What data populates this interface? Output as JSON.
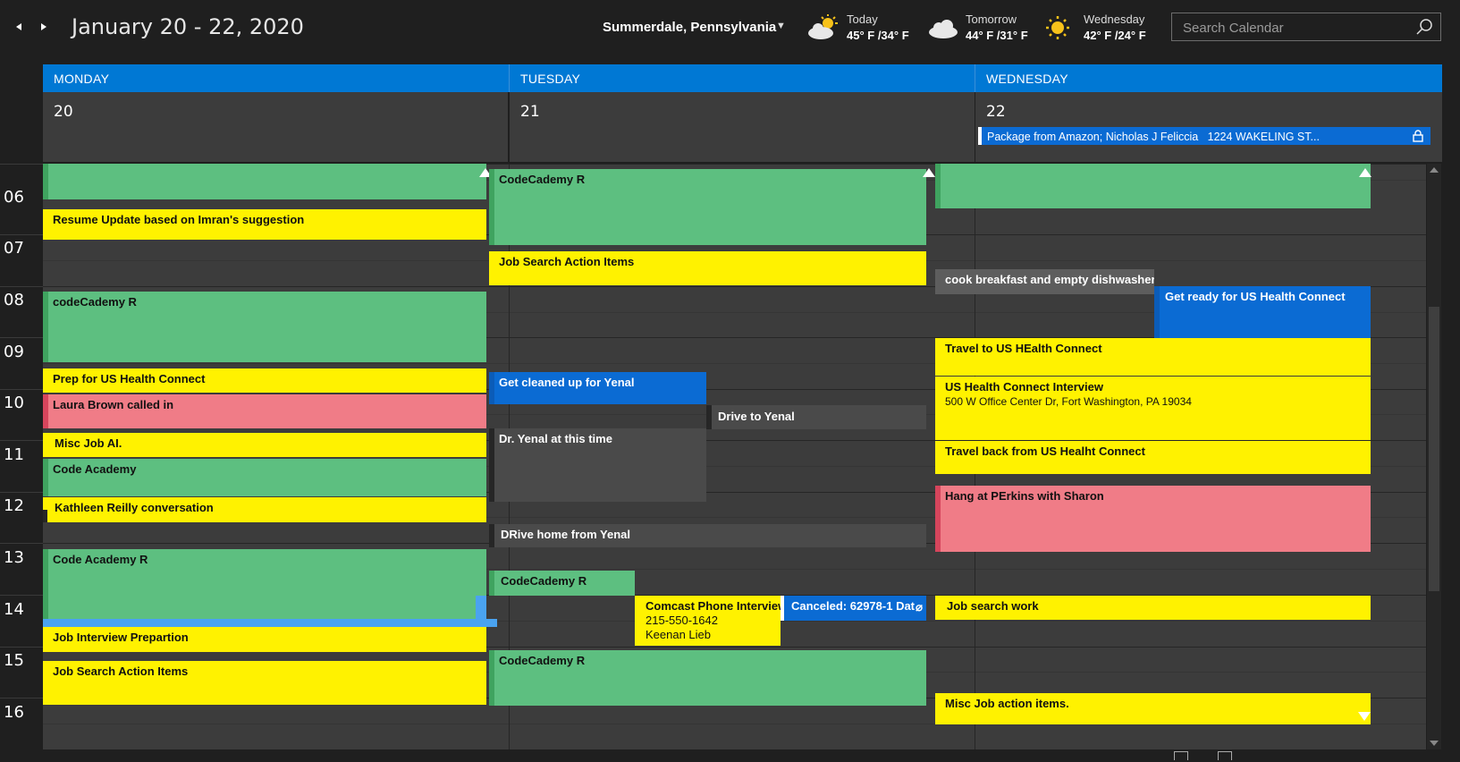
{
  "header": {
    "title": "January 20 - 22, 2020",
    "location": "Summerdale, Pennsylvania",
    "weather": [
      {
        "label": "Today",
        "temps": "45° F /34° F",
        "icon": "partly-cloudy-icon"
      },
      {
        "label": "Tomorrow",
        "temps": "44° F /31° F",
        "icon": "cloudy-icon"
      },
      {
        "label": "Wednesday",
        "temps": "42° F /24° F",
        "icon": "sunny-icon"
      }
    ],
    "search_placeholder": "Search Calendar"
  },
  "days": [
    {
      "name": "MONDAY",
      "date": "20"
    },
    {
      "name": "TUESDAY",
      "date": "21"
    },
    {
      "name": "WEDNESDAY",
      "date": "22"
    }
  ],
  "all_day_events": [
    {
      "day": 2,
      "title": "Package from Amazon; Nicholas J Feliccia",
      "detail": "1224 WAKELING ST...",
      "color": "#0b6bd3",
      "locked": true
    }
  ],
  "hours": [
    "06",
    "07",
    "08",
    "09",
    "10",
    "11",
    "12",
    "13",
    "14",
    "15",
    "16"
  ],
  "events": [
    {
      "title": "Resume Update based on Imran's suggestion",
      "color": "yellow"
    },
    {
      "title": "codeCademy R",
      "color": "green"
    },
    {
      "title": "Prep for US Health Connect",
      "color": "yellow"
    },
    {
      "title": "Laura Brown called in",
      "color": "pink"
    },
    {
      "title": "Misc Job AI.",
      "color": "yellow"
    },
    {
      "title": "Code Academy",
      "color": "green"
    },
    {
      "title": "Kathleen Reilly conversation",
      "color": "yellow"
    },
    {
      "title": "Code Academy R",
      "color": "green"
    },
    {
      "title": "Job Interview Prepartion",
      "color": "yellow"
    },
    {
      "title": "Job Search Action Items",
      "color": "yellow"
    },
    {
      "title": "CodeCademy R",
      "color": "green"
    },
    {
      "title": "Job Search Action Items",
      "color": "yellow"
    },
    {
      "title": "Get cleaned up for Yenal",
      "color": "blue"
    },
    {
      "title": "Drive to Yenal",
      "color": "gray"
    },
    {
      "title": "Dr. Yenal at this time",
      "color": "gray"
    },
    {
      "title": "DRive home from Yenal",
      "color": "gray"
    },
    {
      "title": "CodeCademy R",
      "color": "green"
    },
    {
      "title": "Comcast Phone Interview",
      "line2": "215-550-1642",
      "line3": "Keenan Lieb",
      "color": "yellow"
    },
    {
      "title": "Canceled: 62978-1 Dat",
      "color": "blue"
    },
    {
      "title": "CodeCademy R",
      "color": "green"
    },
    {
      "title": "cook breakfast and empty dishwasher",
      "color": "gray"
    },
    {
      "title": "Get ready for US Health Connect",
      "color": "blue"
    },
    {
      "title": "Travel to US HEalth Connect",
      "color": "yellow"
    },
    {
      "title": "US Health Connect Interview",
      "line2": "500 W Office Center Dr, Fort Washington, PA 19034",
      "color": "yellow"
    },
    {
      "title": "Travel back from US Healht Connect",
      "color": "yellow"
    },
    {
      "title": "Hang at PErkins with Sharon",
      "color": "pink"
    },
    {
      "title": "Job search work",
      "color": "yellow"
    },
    {
      "title": "Misc Job action items.",
      "color": "yellow"
    }
  ]
}
